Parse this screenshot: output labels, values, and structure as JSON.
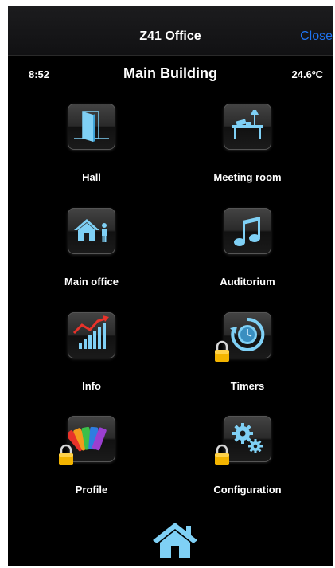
{
  "navbar": {
    "title": "Z41 Office",
    "close_label": "Close"
  },
  "status": {
    "time": "8:52",
    "title": "Main Building",
    "temperature": "24.6ºC"
  },
  "tiles": [
    {
      "label": "Hall",
      "icon": "door-icon",
      "locked": false
    },
    {
      "label": "Meeting room",
      "icon": "desk-lamp-icon",
      "locked": false
    },
    {
      "label": "Main office",
      "icon": "house-person-icon",
      "locked": false
    },
    {
      "label": "Auditorium",
      "icon": "music-note-icon",
      "locked": false
    },
    {
      "label": "Info",
      "icon": "bar-chart-icon",
      "locked": false
    },
    {
      "label": "Timers",
      "icon": "timer-icon",
      "locked": true
    },
    {
      "label": "Profile",
      "icon": "color-palette-icon",
      "locked": true
    },
    {
      "label": "Configuration",
      "icon": "gears-icon",
      "locked": true
    }
  ],
  "home": {
    "icon": "home-icon"
  },
  "colors": {
    "accent_blue": "#1f74f2",
    "icon_blue": "#7fd0f5",
    "lock_gold": "#f3b400"
  }
}
